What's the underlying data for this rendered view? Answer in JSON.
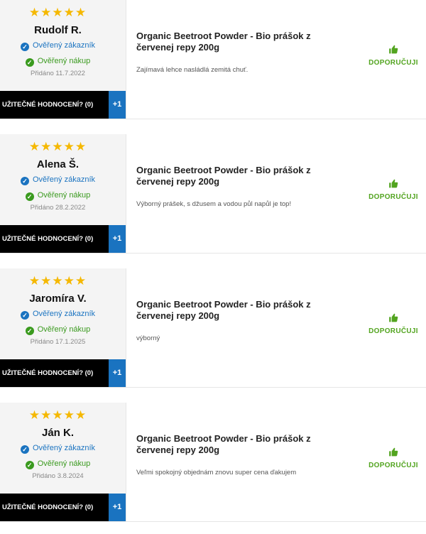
{
  "reviews": [
    {
      "stars": "★★★★★",
      "author": "Rudolf R.",
      "verified_customer": "Ověřený zákazník",
      "verified_purchase": "Ověřený nákup",
      "added": "Přidáno 11.7.2022",
      "useful_label": "UŽITEČNÉ HODNOCENÍ?",
      "useful_count": "(0)",
      "plus_label": "+1",
      "product_title": "Organic Beetroot Powder - Bio prášok z červenej repy 200g",
      "text": "Zajímavá lehce nasládlá zemitá chuť.",
      "recommend_label": "DOPORUČUJI"
    },
    {
      "stars": "★★★★★",
      "author": "Alena Š.",
      "verified_customer": "Ověřený zákazník",
      "verified_purchase": "Ověřený nákup",
      "added": "Přidáno 28.2.2022",
      "useful_label": "UŽITEČNÉ HODNOCENÍ?",
      "useful_count": "(0)",
      "plus_label": "+1",
      "product_title": "Organic Beetroot Powder - Bio prášok z červenej repy 200g",
      "text": "Výborný prášek, s džusem a vodou půl napůl je top!",
      "recommend_label": "DOPORUČUJI"
    },
    {
      "stars": "★★★★★",
      "author": "Jaromíra V.",
      "verified_customer": "Ověřený zákazník",
      "verified_purchase": "Ověřený nákup",
      "added": "Přidáno 17.1.2025",
      "useful_label": "UŽITEČNÉ HODNOCENÍ?",
      "useful_count": "(0)",
      "plus_label": "+1",
      "product_title": "Organic Beetroot Powder - Bio prášok z červenej repy 200g",
      "text": "výborný",
      "recommend_label": "DOPORUČUJI"
    },
    {
      "stars": "★★★★★",
      "author": "Ján K.",
      "verified_customer": "Ověřený zákazník",
      "verified_purchase": "Ověřený nákup",
      "added": "Přidáno 3.8.2024",
      "useful_label": "UŽITEČNÉ HODNOCENÍ?",
      "useful_count": "(0)",
      "plus_label": "+1",
      "product_title": "Organic Beetroot Powder - Bio prášok z červenej repy 200g",
      "text": "Veľmi spokojný objednám znovu super cena ďakujem",
      "recommend_label": "DOPORUČUJI"
    }
  ],
  "colors": {
    "star": "#f5b800",
    "verified_customer": "#1a73c0",
    "verified_purchase": "#3a9a1e",
    "recommend": "#52a41f",
    "useful_bg": "#000000",
    "plus_bg": "#1a73c0"
  },
  "icons": {
    "customer_badge": "check-circle-icon",
    "purchase_badge": "check-circle-icon",
    "recommend": "thumbs-up-icon"
  }
}
